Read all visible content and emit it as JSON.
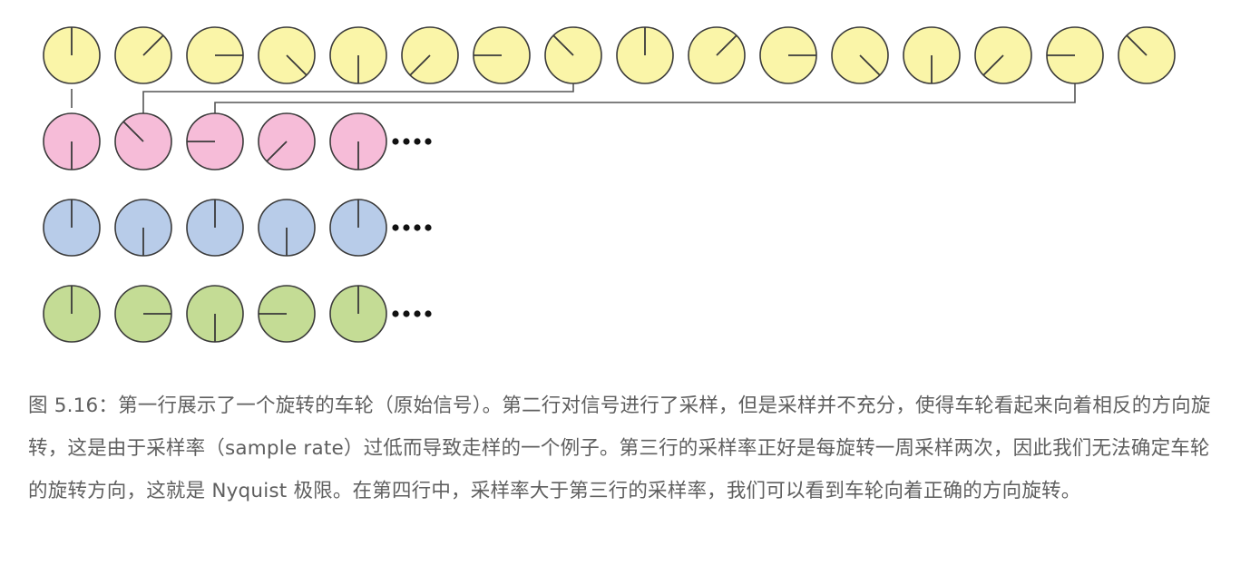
{
  "figure": {
    "colors": {
      "row1": "#faf5a8",
      "row2": "#f6bcd8",
      "row3": "#b8cce9",
      "row4": "#c4dc95",
      "stroke": "#3a3a3a",
      "connector": "#555555",
      "dots": "#111111"
    },
    "rows": [
      {
        "name": "original-signal-row",
        "fill": "row1",
        "hands": [
          "up",
          "up-right",
          "right",
          "down-right",
          "down",
          "down-left",
          "left",
          "up-left",
          "up",
          "up-right",
          "right",
          "down-right",
          "down",
          "down-left",
          "left",
          "up-left"
        ],
        "ellipsis": false
      },
      {
        "name": "undersampled-row",
        "fill": "row2",
        "hands": [
          "down",
          "up-left",
          "left",
          "down-left",
          "down"
        ],
        "ellipsis": true
      },
      {
        "name": "nyquist-row",
        "fill": "row3",
        "hands": [
          "up",
          "down",
          "up",
          "down",
          "up"
        ],
        "ellipsis": true
      },
      {
        "name": "oversampled-row",
        "fill": "row4",
        "hands": [
          "up",
          "right",
          "down",
          "left",
          "up"
        ],
        "ellipsis": true
      }
    ],
    "connectors": [
      {
        "from": 0,
        "to": 0
      },
      {
        "from": 7,
        "to": 1
      },
      {
        "from": 14,
        "to": 2
      }
    ]
  },
  "caption": {
    "text": "图 5.16：第一行展示了一个旋转的车轮（原始信号）。第二行对信号进行了采样，但是采样并不充分，使得车轮看起来向着相反的方向旋转，这是由于采样率（sample rate）过低而导致走样的一个例子。第三行的采样率正好是每旋转一周采样两次，因此我们无法确定车轮的旋转方向，这就是 Nyquist 极限。在第四行中，采样率大于第三行的采样率，我们可以看到车轮向着正确的方向旋转。"
  }
}
